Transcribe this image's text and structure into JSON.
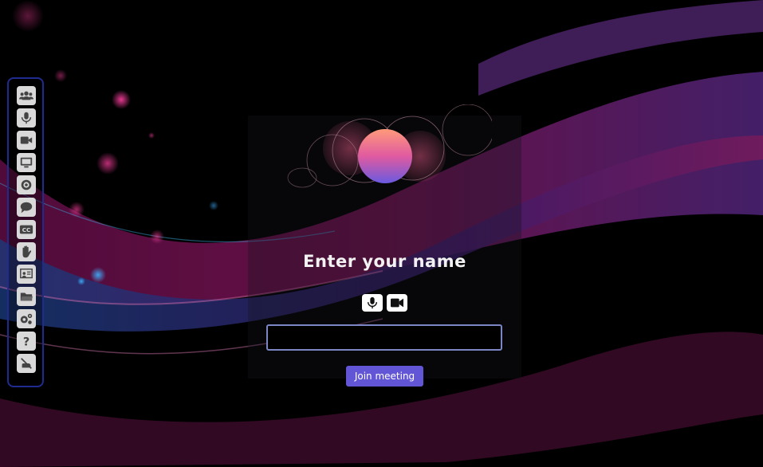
{
  "colors": {
    "background": "#000000",
    "accent": "#6256d6",
    "sidebar_border": "#1f2b8f",
    "input_border": "#7d86c4"
  },
  "sidebar": {
    "items": [
      {
        "icon": "participants-icon"
      },
      {
        "icon": "microphone-icon"
      },
      {
        "icon": "video-camera-icon"
      },
      {
        "icon": "screen-share-icon"
      },
      {
        "icon": "record-icon"
      },
      {
        "icon": "chat-icon"
      },
      {
        "icon": "closed-captions-icon"
      },
      {
        "icon": "raise-hand-icon"
      },
      {
        "icon": "whiteboard-icon"
      },
      {
        "icon": "folder-icon"
      },
      {
        "icon": "settings-icon"
      },
      {
        "icon": "help-icon"
      },
      {
        "icon": "leave-call-icon"
      }
    ]
  },
  "join": {
    "title": "Enter your name",
    "name_value": "",
    "button_label": "Join meeting"
  }
}
